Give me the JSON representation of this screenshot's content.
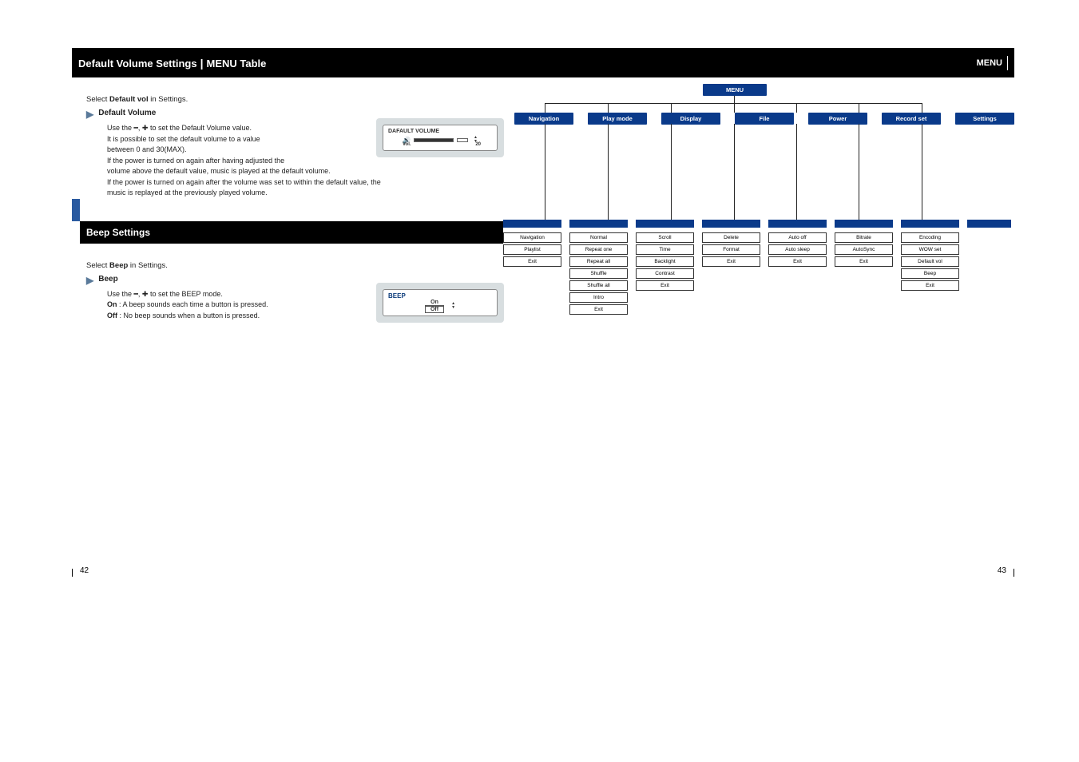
{
  "left_page": {
    "header_title1": "Default Volume Settings",
    "header_title2": "MENU Table",
    "section1": {
      "instruction_prefix": "Select ",
      "instruction_bold": "Default vol",
      "instruction_suffix": " in Settings.",
      "arrow_label": "Default Volume",
      "line1": "Use the ━, ✚ to set the Default Volume value.",
      "line2": "It is possible to set the default volume to a value",
      "line3": "between 0 and 30(MAX).",
      "line4": "If the power is turned on again after having adjusted the",
      "line5": "volume above the default value, music is played at the default volume.",
      "line6": "If the power is turned on again after the volume was set to within the default value, the",
      "line7": "music is replayed at the previously played volume.",
      "lcd_title": "DAFAULT VOLUME",
      "lcd_vol_label": "Vol.",
      "lcd_value": "20"
    },
    "section2": {
      "header": "Beep Settings",
      "instruction_prefix": "Select ",
      "instruction_bold": "Beep",
      "instruction_suffix": " in Settings.",
      "arrow_label": "Beep",
      "line1": "Use the ━, ✚ to set the BEEP mode.",
      "line2_bold": "On",
      "line2": " : A beep sounds each time a button is pressed.",
      "line3_bold": "Off",
      "line3": " : No beep sounds when a button is pressed.",
      "lcd_title": "BEEP",
      "lcd_on": "On",
      "lcd_off": "Off"
    },
    "page_num": "42"
  },
  "right_page": {
    "header_right": "MENU",
    "tree": {
      "root": "MENU",
      "level1": [
        "Navigation",
        "Play mode",
        "Display",
        "File",
        "Power",
        "Record set",
        "Settings"
      ],
      "cols": [
        {
          "head": "Navigation",
          "items": [
            "Navigation",
            "Playlist",
            "Exit"
          ]
        },
        {
          "head": "Play Mode",
          "items": [
            "Normal",
            "Repeat one",
            "Repeat all",
            "Shuffle",
            "Shuffle all",
            "Intro",
            "Exit"
          ]
        },
        {
          "head": "Display",
          "items": [
            "Scroll",
            "Time",
            "Backlight",
            "Contrast",
            "Exit"
          ]
        },
        {
          "head": "File",
          "items": [
            "Delete",
            "Format",
            "Exit"
          ]
        },
        {
          "head": "Power",
          "items": [
            "Auto off",
            "Auto sleep",
            "Exit"
          ]
        },
        {
          "head": "Record Set",
          "items": [
            "Bitrate",
            "AutoSync",
            "Exit"
          ]
        },
        {
          "head": "Settings",
          "items": [
            "Encoding",
            "WOW set",
            "Default vol",
            "Beep",
            "Exit"
          ]
        }
      ]
    },
    "page_num": "43"
  }
}
